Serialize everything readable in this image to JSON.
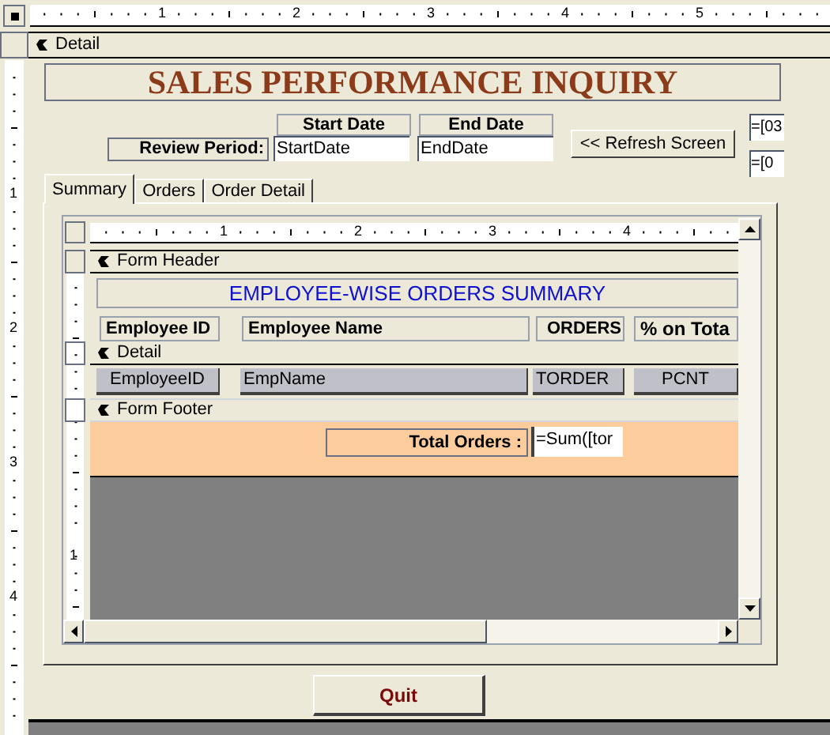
{
  "top_ruler": {
    "marks": [
      "1",
      "2",
      "3",
      "4",
      "5"
    ]
  },
  "left_ruler": {
    "marks": [
      "1",
      "2",
      "3",
      "4"
    ]
  },
  "section": {
    "label": "Detail"
  },
  "title": "SALES PERFORMANCE INQUIRY",
  "review_period": {
    "label": "Review Period:"
  },
  "start_date": {
    "label": "Start Date",
    "value": "StartDate"
  },
  "end_date": {
    "label": "End Date",
    "value": "EndDate"
  },
  "refresh_button": "<< Refresh Screen",
  "side_fields": [
    "=[03",
    "=[0"
  ],
  "tabs": [
    {
      "label": "Summary",
      "selected": true
    },
    {
      "label": "Orders",
      "selected": false
    },
    {
      "label": "Order Detail",
      "selected": false
    }
  ],
  "subform": {
    "top_ruler": {
      "marks": [
        "1",
        "2",
        "3",
        "4"
      ]
    },
    "left_ruler": {
      "marks": [
        "1"
      ]
    },
    "form_header": {
      "label": "Form Header",
      "title": "EMPLOYEE-WISE ORDERS SUMMARY",
      "columns": [
        "Employee ID",
        "Employee Name",
        "ORDERS",
        "% on Tota"
      ]
    },
    "detail": {
      "label": "Detail",
      "fields": [
        "EmployeeID",
        "EmpName",
        "TORDER",
        "PCNT"
      ]
    },
    "form_footer": {
      "label": "Form Footer",
      "total_label": "Total Orders :",
      "total_value": "=Sum([tor"
    }
  },
  "quit_button": "Quit"
}
